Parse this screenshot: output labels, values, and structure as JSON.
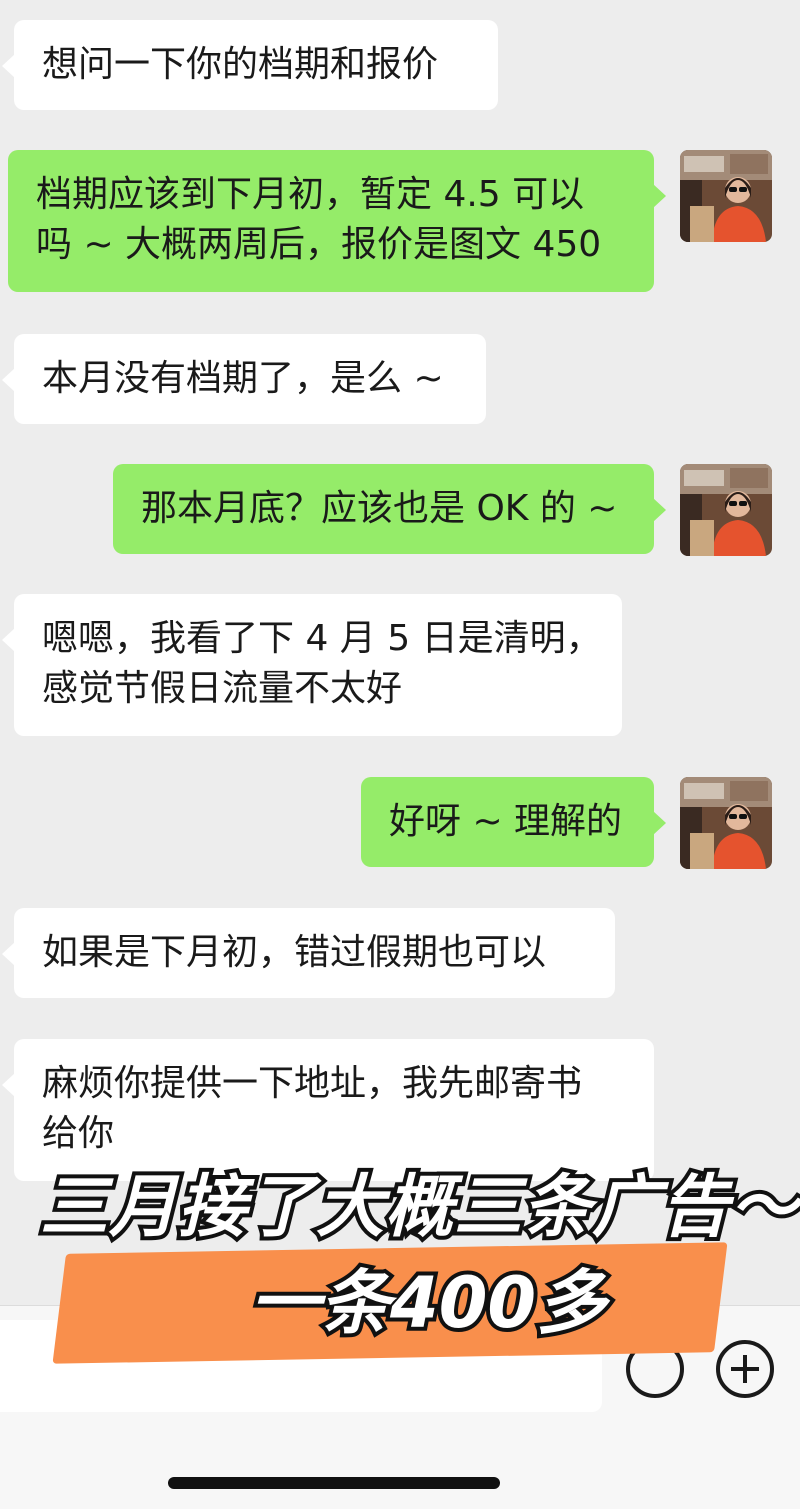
{
  "messages": [
    {
      "side": "received",
      "lines": [
        "想问一下你的档期和报价"
      ]
    },
    {
      "side": "sent",
      "lines": [
        "档期应该到下月初，暂定 4.5 可以",
        "吗 ~ 大概两周后，报价是图文 450"
      ]
    },
    {
      "side": "received",
      "lines": [
        "本月没有档期了，是么 ~"
      ]
    },
    {
      "side": "sent",
      "lines": [
        "那本月底？应该也是 OK 的 ~"
      ]
    },
    {
      "side": "received",
      "lines": [
        "嗯嗯，我看了下 4 月 5 日是清明，",
        "感觉节假日流量不太好"
      ]
    },
    {
      "side": "sent",
      "lines": [
        "好呀 ~ 理解的"
      ]
    },
    {
      "side": "received",
      "lines": [
        "如果是下月初，错过假期也可以"
      ]
    },
    {
      "side": "received",
      "lines": [
        "麻烦你提供一下地址，我先邮寄书",
        "给你"
      ]
    }
  ],
  "overlay": {
    "line1": "三月接了大概三条广告～",
    "line2": "一条400多",
    "highlight_color": "#f98f4c"
  },
  "icons": {
    "emoji": "emoji-icon",
    "plus": "plus-icon",
    "avatar": "user-avatar"
  },
  "colors": {
    "background": "#ededed",
    "sent_bubble": "#95ec69",
    "received_bubble": "#ffffff"
  }
}
